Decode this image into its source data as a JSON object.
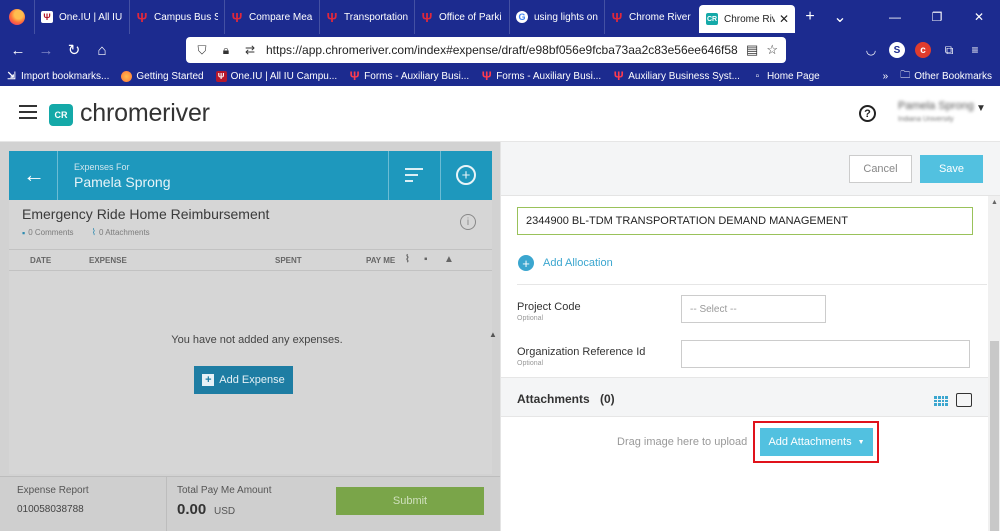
{
  "browser": {
    "tabs": [
      {
        "label": "One.IU | All IU",
        "favicon": "iu-trident-icon"
      },
      {
        "label": "Campus Bus Se",
        "favicon": "iu-trident-icon"
      },
      {
        "label": "Compare Meal",
        "favicon": "iu-trident-icon"
      },
      {
        "label": "Transportation",
        "favicon": "iu-trident-icon"
      },
      {
        "label": "Office of Parki",
        "favicon": "iu-trident-icon"
      },
      {
        "label": "using lights on",
        "favicon": "google-icon"
      },
      {
        "label": "Chrome River T",
        "favicon": "iu-trident-icon"
      },
      {
        "label": "Chrome Riv",
        "favicon": "chromeriver-icon",
        "active": true
      }
    ],
    "url": "https://app.chromeriver.com/index#expense/draft/e98bf056e9fcba73aa2c83e56ee646f58c8c3dd8778",
    "bookmarks": [
      {
        "label": "Import bookmarks..."
      },
      {
        "label": "Getting Started"
      },
      {
        "label": "One.IU | All IU Campu..."
      },
      {
        "label": "Forms - Auxiliary Busi..."
      },
      {
        "label": "Forms - Auxiliary Busi..."
      },
      {
        "label": "Auxiliary Business Syst..."
      },
      {
        "label": "Home Page"
      }
    ],
    "other_bookmarks": "Other Bookmarks"
  },
  "app": {
    "logo_text": "chromeriver",
    "logo_mark": "CR",
    "user_name": "Pamela Sprong",
    "user_org": "Indiana University"
  },
  "left": {
    "expenses_for_label": "Expenses For",
    "owner_name": "Pamela Sprong",
    "report_title": "Emergency Ride Home Reimbursement",
    "comments": "0 Comments",
    "attachments": "0 Attachments",
    "columns": {
      "date": "DATE",
      "expense": "EXPENSE",
      "spent": "SPENT",
      "pay_me": "PAY ME"
    },
    "empty_message": "You have not added any expenses.",
    "add_expense": "Add Expense",
    "footer": {
      "report_label": "Expense Report",
      "report_number": "010058038788",
      "total_label": "Total Pay Me Amount",
      "total_amount": "0.00",
      "currency": "USD",
      "submit": "Submit"
    }
  },
  "right": {
    "cancel": "Cancel",
    "save": "Save",
    "allocation_value": "2344900 BL-TDM TRANSPORTATION DEMAND MANAGEMENT",
    "add_allocation": "Add Allocation",
    "project_code_label": "Project Code",
    "project_code_optional": "Optional",
    "project_code_placeholder": "-- Select --",
    "org_ref_label": "Organization Reference Id",
    "org_ref_optional": "Optional",
    "attachments_title": "Attachments",
    "attachments_count": "(0)",
    "drag_text": "Drag image here to upload",
    "add_attachments": "Add Attachments"
  },
  "colors": {
    "browser_chrome": "#1c2b8f",
    "brand_teal": "#14a9a8",
    "primary_blue": "#52c1e0",
    "highlight_red": "#e0121b",
    "submit_green": "#7aa549"
  }
}
